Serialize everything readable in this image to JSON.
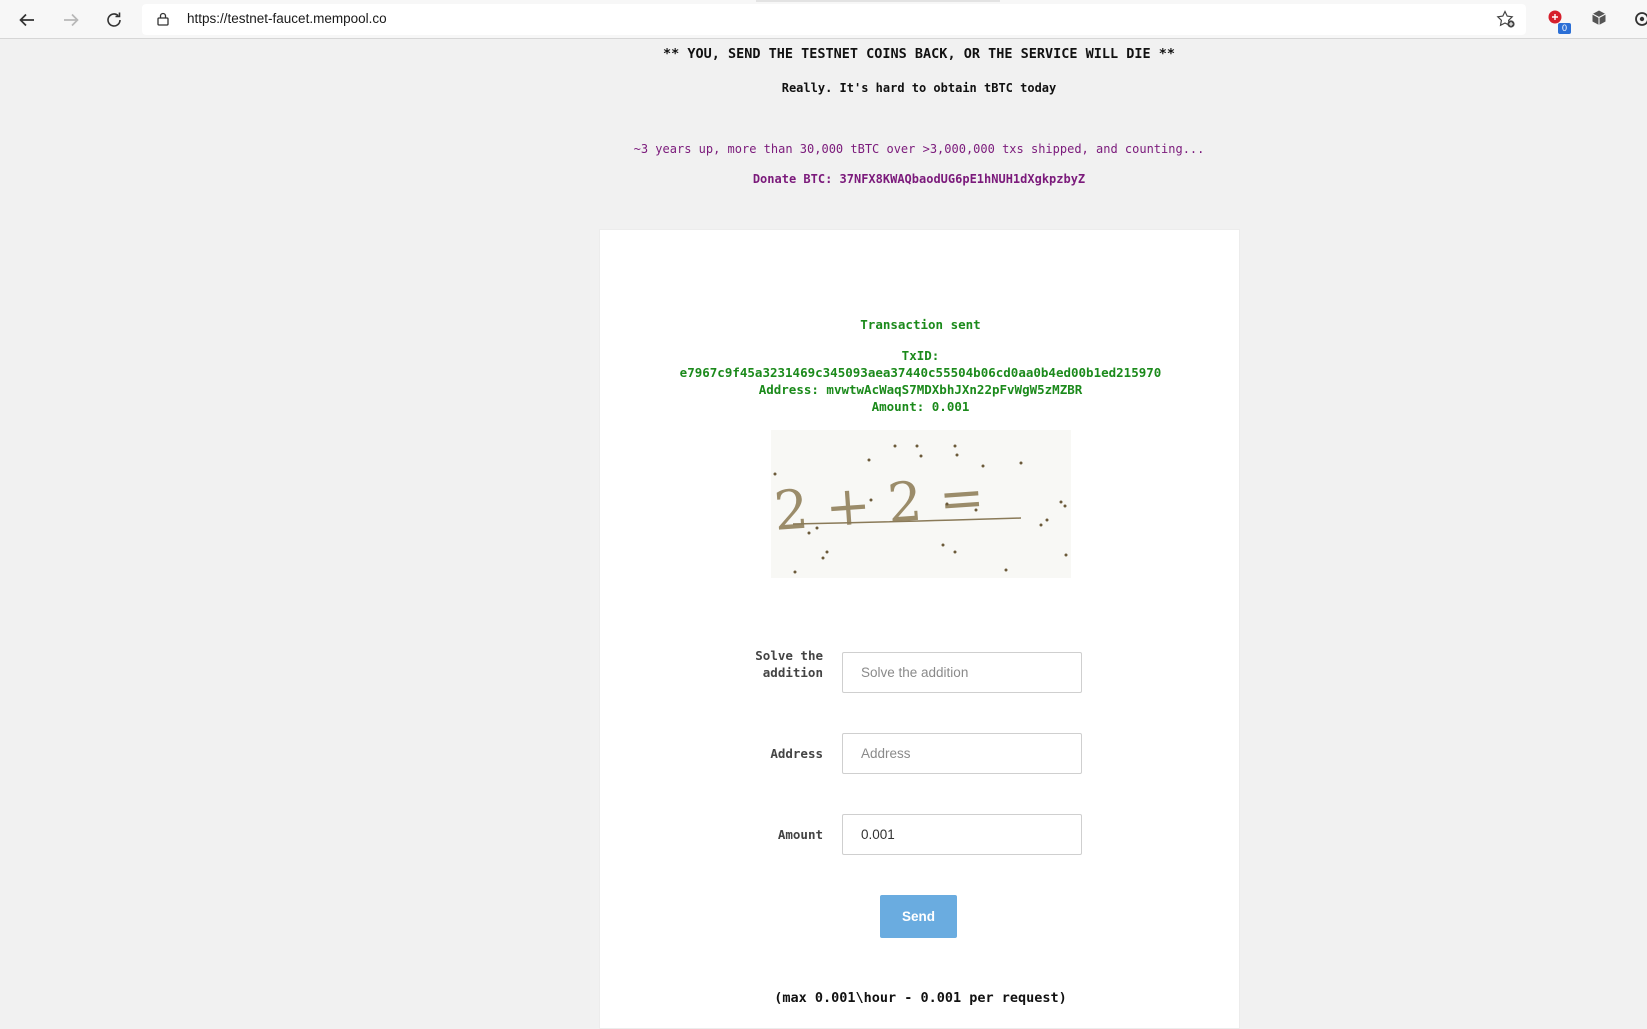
{
  "browser": {
    "url": "https://testnet-faucet.mempool.co",
    "extension_badge": "0",
    "icons": [
      "back-arrow-icon",
      "forward-arrow-icon",
      "reload-icon",
      "lock-icon",
      "add-favorite-icon",
      "extension-icon",
      "cube-icon",
      "settings-icon"
    ]
  },
  "page": {
    "warning": "** YOU, SEND THE TESTNET COINS BACK, OR THE SERVICE WILL DIE **",
    "subtitle": "Really. It's hard to obtain tBTC today",
    "stats": "~3 years up, more than 30,000 tBTC over >3,000,000 txs shipped, and counting...",
    "donate": "Donate BTC: 37NFX8KWAQbaodUG6pE1hNUH1dXgkpzbyZ"
  },
  "result": {
    "status": "Transaction sent",
    "txid_label": "TxID:",
    "txid": "e7967c9f45a3231469c345093aea37440c55504b06cd0aa0b4ed00b1ed215970",
    "address_line": "Address: mvwtwAcWaqS7MDXbhJXn22pFvWgW5zMZBR",
    "amount_line": "Amount: 0.001"
  },
  "captcha": {
    "text": "2 + 2 ="
  },
  "form": {
    "captcha_label": "Solve the addition",
    "captcha_placeholder": "Solve the addition",
    "address_label": "Address",
    "address_placeholder": "Address",
    "amount_label": "Amount",
    "amount_value": "0.001",
    "send_label": "Send",
    "limit_note": "(max 0.001\\hour - 0.001 per request)"
  },
  "colors": {
    "accent_purple": "#7b1a7b",
    "success_green": "#1b8a1b",
    "button_blue": "#6aace0"
  }
}
